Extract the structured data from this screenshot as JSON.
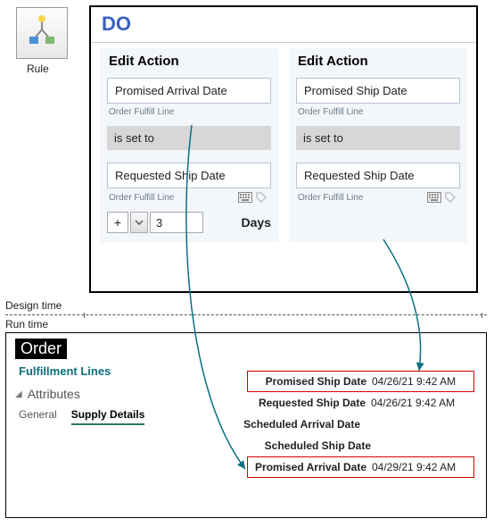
{
  "rule_icon": {
    "label": "Rule",
    "icon": "flow-icon"
  },
  "do_panel": {
    "header": "DO",
    "left": {
      "title": "Edit Action",
      "target_field": "Promised Arrival Date",
      "target_note": "Order Fulfill Line",
      "operator": "is set to",
      "source_field": "Requested Ship Date",
      "source_note": "Order Fulfill Line",
      "plus": "+",
      "drop": "v",
      "number": "3",
      "unit": "Days"
    },
    "right": {
      "title": "Edit Action",
      "target_field": "Promised Ship Date",
      "target_note": "Order Fulfill Line",
      "operator": "is set to",
      "source_field": "Requested Ship Date",
      "source_note": "Order Fulfill Line"
    }
  },
  "timeline": {
    "design_label": "Design time",
    "run_label": "Run time"
  },
  "runtime": {
    "order_label": "Order",
    "fulfillment_lines": "Fulfillment Lines",
    "attributes": "Attributes",
    "tabs": {
      "general": "General",
      "supply": "Supply Details"
    },
    "rows": {
      "promised_ship": {
        "label": "Promised Ship Date",
        "value": "04/26/21 9:42 AM"
      },
      "requested_ship": {
        "label": "Requested Ship Date",
        "value": "04/26/21 9:42 AM"
      },
      "scheduled_arrival": {
        "label": "Scheduled Arrival Date",
        "value": ""
      },
      "scheduled_ship": {
        "label": "Scheduled Ship Date",
        "value": ""
      },
      "promised_arrival": {
        "label": "Promised Arrival Date",
        "value": "04/29/21 9:42 AM"
      }
    }
  }
}
